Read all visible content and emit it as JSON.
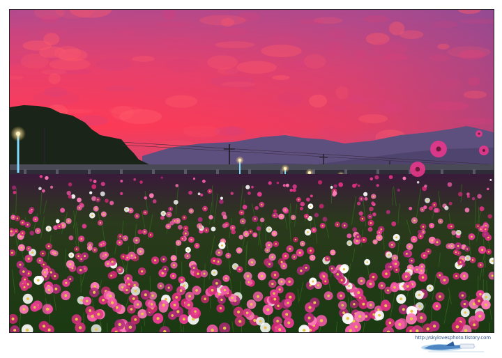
{
  "photo": {
    "sky_color_top": "#b44a8c",
    "sky_color_glow": "#ff3a58",
    "mountain_color": "#5d4f7e",
    "flower_color": "#e63c92",
    "foliage_color": "#1d3a14"
  },
  "watermark": {
    "url": "http://skylovesphoto.tistory.com",
    "logo": "bird-logo"
  }
}
